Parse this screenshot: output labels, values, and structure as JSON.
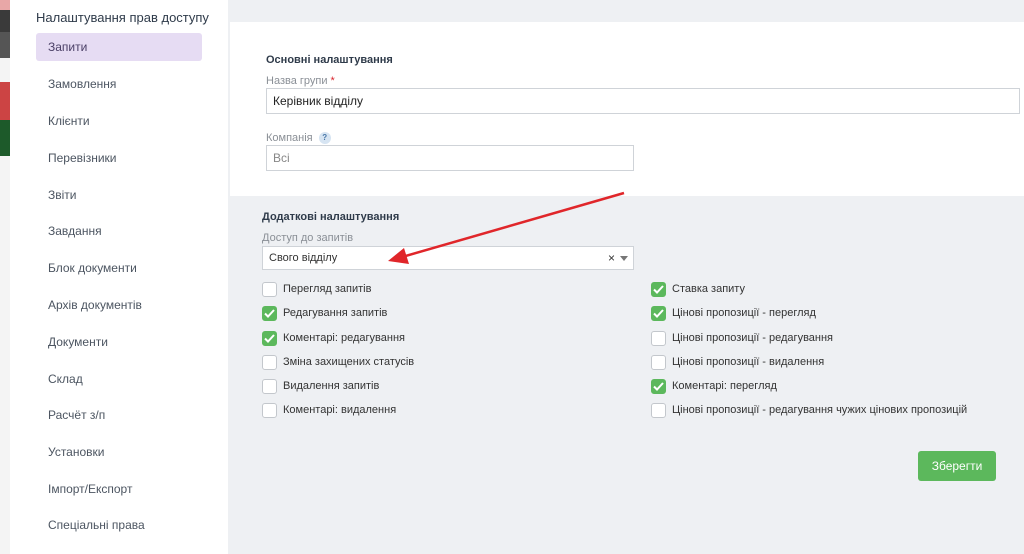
{
  "menu": {
    "title": "Налаштування прав доступу",
    "items": [
      {
        "label": "Запити",
        "active": true
      },
      {
        "label": "Замовлення"
      },
      {
        "label": "Клієнти"
      },
      {
        "label": "Перевізники"
      },
      {
        "label": "Звіти"
      },
      {
        "label": "Завдання"
      },
      {
        "label": "Блок документи"
      },
      {
        "label": "Архів документів"
      },
      {
        "label": "Документи"
      },
      {
        "label": "Склад"
      },
      {
        "label": "Расчёт з/п"
      },
      {
        "label": "Установки"
      },
      {
        "label": "Імпорт/Експорт"
      },
      {
        "label": "Спеціальні права"
      }
    ]
  },
  "basic": {
    "title": "Основні налаштування",
    "group_label": "Назва групи",
    "group_required": "*",
    "group_value": "Керівник відділу",
    "company_label": "Компанія",
    "company_help": "?",
    "company_value": "Всі"
  },
  "additional": {
    "title": "Додаткові налаштування",
    "access_label": "Доступ до запитів",
    "access_value": "Свого відділу",
    "access_clear": "×"
  },
  "permissions": {
    "left": [
      {
        "label": "Перегляд запитів",
        "checked": false
      },
      {
        "label": "Редагування запитів",
        "checked": true
      },
      {
        "label": "Коментарі: редагування",
        "checked": true
      },
      {
        "label": "Зміна захищених статусів",
        "checked": false
      },
      {
        "label": "Видалення запитів",
        "checked": false
      },
      {
        "label": "Коментарі: видалення",
        "checked": false
      }
    ],
    "right": [
      {
        "label": "Ставка запиту",
        "checked": true
      },
      {
        "label": "Цінові пропозиції - перегляд",
        "checked": true
      },
      {
        "label": "Цінові пропозиції - редагування",
        "checked": false
      },
      {
        "label": "Цінові пропозиції - видалення",
        "checked": false
      },
      {
        "label": "Коментарі: перегляд",
        "checked": true
      },
      {
        "label": "Цінові пропозиції - редагування чужих цінових пропозицій",
        "checked": false
      }
    ]
  },
  "actions": {
    "save_label": "Зберегти"
  },
  "colors": {
    "accent_green": "#5cb85c",
    "menu_active": "#e6dcf3",
    "annotation_arrow": "#e0262a"
  }
}
